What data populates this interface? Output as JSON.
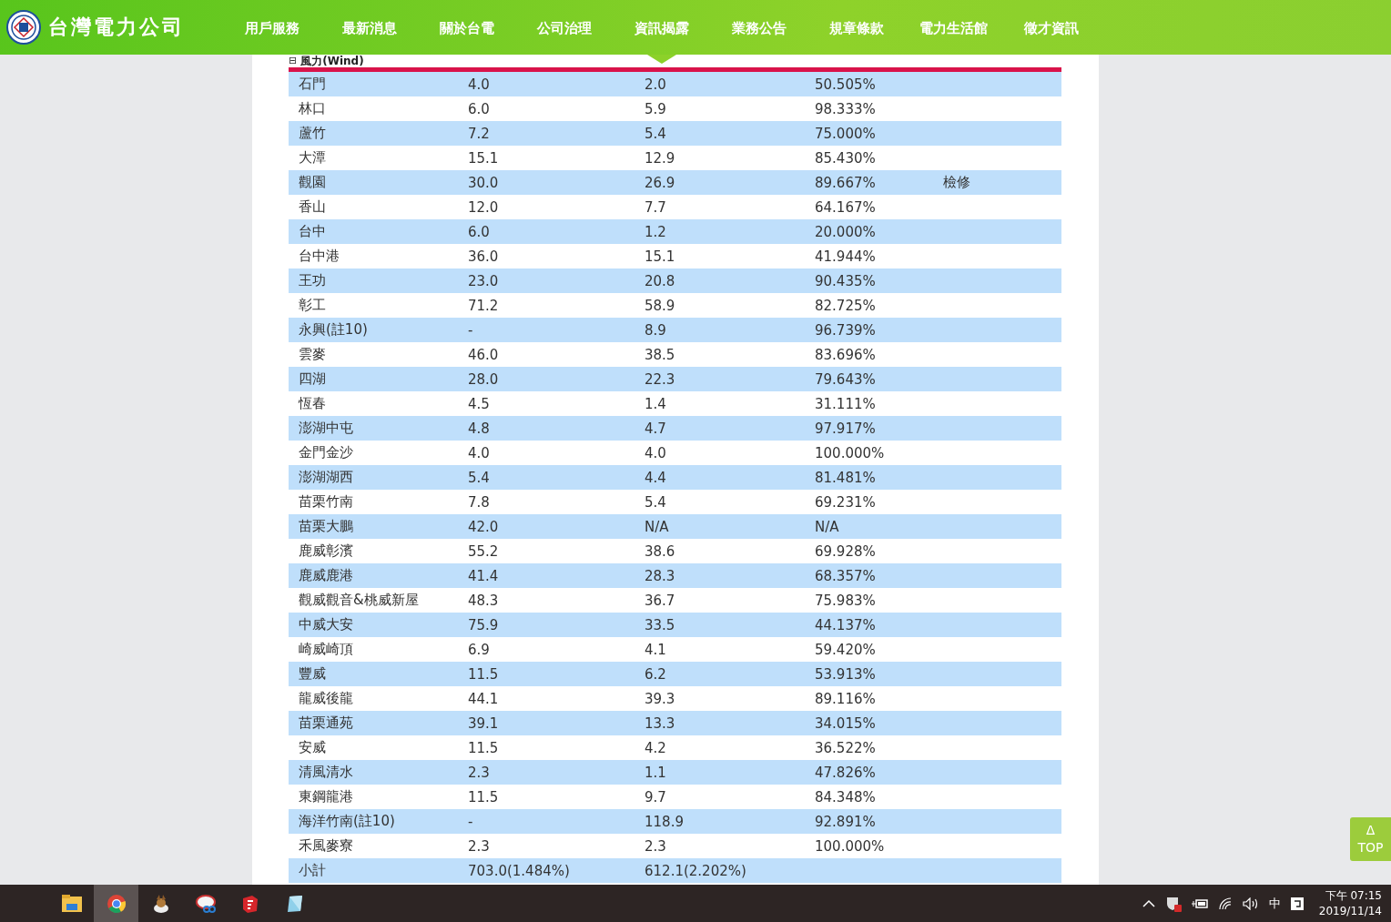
{
  "header": {
    "logo_text": "台灣電力公司",
    "nav": [
      {
        "label": "用戶服務",
        "selected": false
      },
      {
        "label": "最新消息",
        "selected": false
      },
      {
        "label": "關於台電",
        "selected": false
      },
      {
        "label": "公司治理",
        "selected": false
      },
      {
        "label": "資訊揭露",
        "selected": true
      },
      {
        "label": "業務公告",
        "selected": false
      },
      {
        "label": "規章條款",
        "selected": false
      },
      {
        "label": "電力生活館",
        "selected": false
      },
      {
        "label": "徵才資訊",
        "selected": false
      }
    ]
  },
  "section": {
    "toggle": "⊟",
    "title": "風力(Wind)"
  },
  "table": {
    "rows": [
      [
        "石門",
        "4.0",
        "2.0",
        "50.505%",
        ""
      ],
      [
        "林口",
        "6.0",
        "5.9",
        "98.333%",
        ""
      ],
      [
        "蘆竹",
        "7.2",
        "5.4",
        "75.000%",
        ""
      ],
      [
        "大潭",
        "15.1",
        "12.9",
        "85.430%",
        ""
      ],
      [
        "觀園",
        "30.0",
        "26.9",
        "89.667%",
        "檢修"
      ],
      [
        "香山",
        "12.0",
        "7.7",
        "64.167%",
        ""
      ],
      [
        "台中",
        "6.0",
        "1.2",
        "20.000%",
        ""
      ],
      [
        "台中港",
        "36.0",
        "15.1",
        "41.944%",
        ""
      ],
      [
        "王功",
        "23.0",
        "20.8",
        "90.435%",
        ""
      ],
      [
        "彰工",
        "71.2",
        "58.9",
        "82.725%",
        ""
      ],
      [
        "永興(註10)",
        "-",
        "8.9",
        "96.739%",
        ""
      ],
      [
        "雲麥",
        "46.0",
        "38.5",
        "83.696%",
        ""
      ],
      [
        "四湖",
        "28.0",
        "22.3",
        "79.643%",
        ""
      ],
      [
        "恆春",
        "4.5",
        "1.4",
        "31.111%",
        ""
      ],
      [
        "澎湖中屯",
        "4.8",
        "4.7",
        "97.917%",
        ""
      ],
      [
        "金門金沙",
        "4.0",
        "4.0",
        "100.000%",
        ""
      ],
      [
        "澎湖湖西",
        "5.4",
        "4.4",
        "81.481%",
        ""
      ],
      [
        "苗栗竹南",
        "7.8",
        "5.4",
        "69.231%",
        ""
      ],
      [
        "苗栗大鵬",
        "42.0",
        "N/A",
        "N/A",
        ""
      ],
      [
        "鹿威彰濱",
        "55.2",
        "38.6",
        "69.928%",
        ""
      ],
      [
        "鹿威鹿港",
        "41.4",
        "28.3",
        "68.357%",
        ""
      ],
      [
        "觀威觀音&桃威新屋",
        "48.3",
        "36.7",
        "75.983%",
        ""
      ],
      [
        "中威大安",
        "75.9",
        "33.5",
        "44.137%",
        ""
      ],
      [
        "崎威崎頂",
        "6.9",
        "4.1",
        "59.420%",
        ""
      ],
      [
        "豐威",
        "11.5",
        "6.2",
        "53.913%",
        ""
      ],
      [
        "龍威後龍",
        "44.1",
        "39.3",
        "89.116%",
        ""
      ],
      [
        "苗栗通苑",
        "39.1",
        "13.3",
        "34.015%",
        ""
      ],
      [
        "安威",
        "11.5",
        "4.2",
        "36.522%",
        ""
      ],
      [
        "清風清水",
        "2.3",
        "1.1",
        "47.826%",
        ""
      ],
      [
        "東鋼龍港",
        "11.5",
        "9.7",
        "84.348%",
        ""
      ],
      [
        "海洋竹南(註10)",
        "-",
        "118.9",
        "92.891%",
        ""
      ],
      [
        "禾風麥寮",
        "2.3",
        "2.3",
        "100.000%",
        ""
      ],
      [
        "小計",
        "703.0(1.484%)",
        "612.1(2.202%)",
        "",
        ""
      ]
    ]
  },
  "top_button": {
    "arrow": "Δ",
    "label": "TOP"
  },
  "taskbar": {
    "ime": "中",
    "time": "下午 07:15",
    "date": "2019/11/14"
  }
}
